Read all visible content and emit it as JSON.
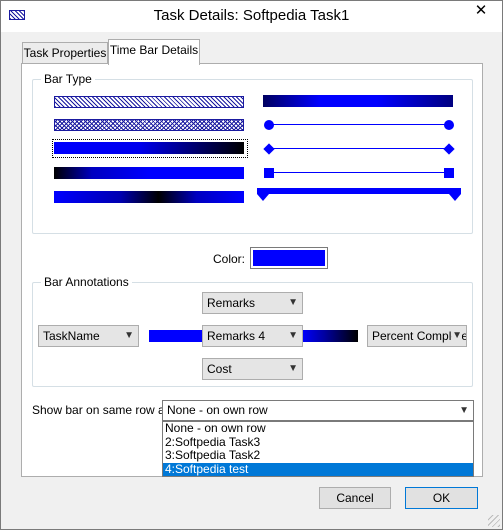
{
  "window": {
    "title": "Task Details: Softpedia Task1",
    "close_glyph": "✕"
  },
  "tabs": [
    {
      "label": "Task Properties",
      "active": false
    },
    {
      "label": "Time Bar Details",
      "active": true
    }
  ],
  "bar_type": {
    "group_label": "Bar Type",
    "selected_style": "blue-black-gradient",
    "bar_color": "#0000ff"
  },
  "color": {
    "label": "Color:",
    "value": "#0000ff"
  },
  "annotations": {
    "group_label": "Bar Annotations",
    "top": "Remarks",
    "left": "TaskName",
    "center": "Remarks 4",
    "right": "Percent Complete",
    "bottom": "Cost"
  },
  "same_row": {
    "label": "Show bar on same row as:",
    "value": "None - on own row",
    "options": [
      "None - on own row",
      "2:Softpedia Task3",
      "3:Softpedia Task2",
      "4:Softpedia test"
    ],
    "highlighted_index": 3
  },
  "buttons": {
    "cancel": "Cancel",
    "ok": "OK"
  },
  "colors": {
    "accent": "#0000ff",
    "selection": "#0078d7"
  }
}
